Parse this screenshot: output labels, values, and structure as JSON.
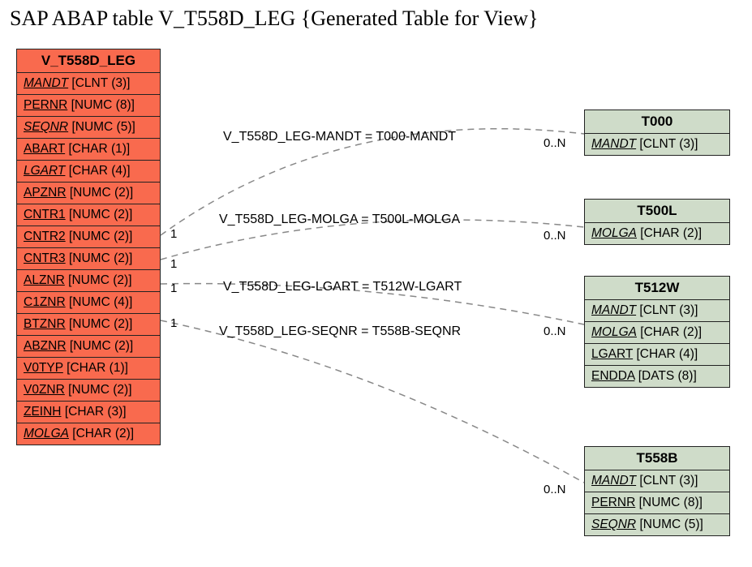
{
  "title": "SAP ABAP table V_T558D_LEG {Generated Table for View}",
  "main_entity": {
    "name": "V_T558D_LEG",
    "fields": [
      {
        "name": "MANDT",
        "type": "[CLNT (3)]",
        "key": true
      },
      {
        "name": "PERNR",
        "type": "[NUMC (8)]",
        "key": false
      },
      {
        "name": "SEQNR",
        "type": "[NUMC (5)]",
        "key": true
      },
      {
        "name": "ABART",
        "type": "[CHAR (1)]",
        "key": false
      },
      {
        "name": "LGART",
        "type": "[CHAR (4)]",
        "key": true
      },
      {
        "name": "APZNR",
        "type": "[NUMC (2)]",
        "key": false
      },
      {
        "name": "CNTR1",
        "type": "[NUMC (2)]",
        "key": false
      },
      {
        "name": "CNTR2",
        "type": "[NUMC (2)]",
        "key": false
      },
      {
        "name": "CNTR3",
        "type": "[NUMC (2)]",
        "key": false
      },
      {
        "name": "ALZNR",
        "type": "[NUMC (2)]",
        "key": false
      },
      {
        "name": "C1ZNR",
        "type": "[NUMC (4)]",
        "key": false
      },
      {
        "name": "BTZNR",
        "type": "[NUMC (2)]",
        "key": false
      },
      {
        "name": "ABZNR",
        "type": "[NUMC (2)]",
        "key": false
      },
      {
        "name": "V0TYP",
        "type": "[CHAR (1)]",
        "key": false
      },
      {
        "name": "V0ZNR",
        "type": "[NUMC (2)]",
        "key": false
      },
      {
        "name": "ZEINH",
        "type": "[CHAR (3)]",
        "key": false
      },
      {
        "name": "MOLGA",
        "type": "[CHAR (2)]",
        "key": true
      }
    ]
  },
  "related_entities": [
    {
      "name": "T000",
      "fields": [
        {
          "name": "MANDT",
          "type": "[CLNT (3)]",
          "key": true
        }
      ]
    },
    {
      "name": "T500L",
      "fields": [
        {
          "name": "MOLGA",
          "type": "[CHAR (2)]",
          "key": true
        }
      ]
    },
    {
      "name": "T512W",
      "fields": [
        {
          "name": "MANDT",
          "type": "[CLNT (3)]",
          "key": true
        },
        {
          "name": "MOLGA",
          "type": "[CHAR (2)]",
          "key": true
        },
        {
          "name": "LGART",
          "type": "[CHAR (4)]",
          "key": false
        },
        {
          "name": "ENDDA",
          "type": "[DATS (8)]",
          "key": false
        }
      ]
    },
    {
      "name": "T558B",
      "fields": [
        {
          "name": "MANDT",
          "type": "[CLNT (3)]",
          "key": true
        },
        {
          "name": "PERNR",
          "type": "[NUMC (8)]",
          "key": false
        },
        {
          "name": "SEQNR",
          "type": "[NUMC (5)]",
          "key": true
        }
      ]
    }
  ],
  "relations": [
    {
      "label": "V_T558D_LEG-MANDT = T000-MANDT",
      "left_card": "1",
      "right_card": "0..N"
    },
    {
      "label": "V_T558D_LEG-MOLGA = T500L-MOLGA",
      "left_card": "1",
      "right_card": "0..N"
    },
    {
      "label": "V_T558D_LEG-LGART = T512W-LGART",
      "left_card": "1",
      "right_card": "0..N"
    },
    {
      "label": "V_T558D_LEG-SEQNR = T558B-SEQNR",
      "left_card": "1",
      "right_card": "0..N"
    }
  ]
}
